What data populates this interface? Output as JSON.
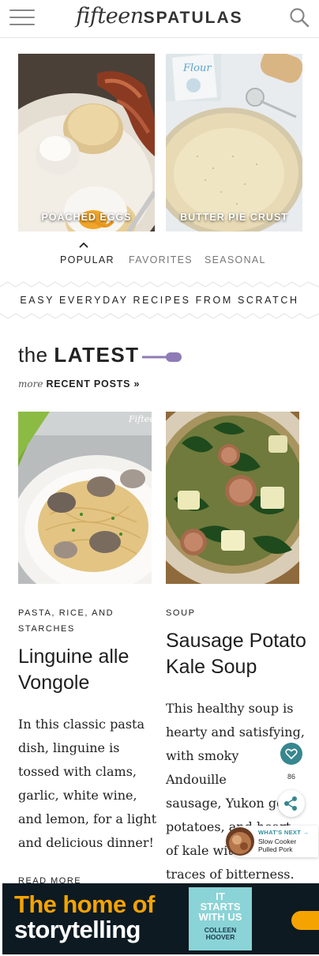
{
  "header": {
    "logo_script": "fifteen",
    "logo_caps": "SPATULAS",
    "menu_icon": "hamburger-menu-icon",
    "search_icon": "search-icon"
  },
  "featured": [
    {
      "label": "POACHED EGGS"
    },
    {
      "label": "BUTTER PIE CRUST"
    }
  ],
  "tabs": [
    {
      "label": "POPULAR",
      "active": true
    },
    {
      "label": "FAVORITES",
      "active": false
    },
    {
      "label": "SEASONAL",
      "active": false
    }
  ],
  "tagline": "EASY EVERYDAY RECIPES FROM SCRATCH",
  "latest": {
    "title_small": "the",
    "title_big": "LATEST",
    "more_prefix": "more",
    "more_link": "RECENT POSTS »"
  },
  "posts": [
    {
      "category_line1": "PASTA, RICE, AND",
      "category_line2": "STARCHES",
      "title_line1": "Linguine alle",
      "title_line2": "Vongole",
      "excerpt": [
        "In this classic pasta",
        "dish, linguine is",
        "tossed with clams,",
        "garlic, white wine,",
        "and lemon, for a light",
        "and delicious dinner!"
      ],
      "image_watermark": "Fiftee",
      "read_more": "READ MORE"
    },
    {
      "category_line1": "SOUP",
      "title_line1": "Sausage Potato",
      "title_line2": "Kale Soup",
      "excerpt": [
        "This healthy soup is",
        "hearty and satisfying,",
        "with smoky",
        "Andouille",
        "sausage, Yukon go",
        "potatoes, and heart",
        "of kale wit",
        "traces of bitterness."
      ]
    }
  ],
  "widgets": {
    "share_count": "86",
    "whats_next_label": "WHAT'S NEXT →",
    "whats_next_title_line1": "Slow Cooker",
    "whats_next_title_line2": "Pulled Pork"
  },
  "ad": {
    "line1": "The home of",
    "line2": "storytelling",
    "book_title_line1": "IT",
    "book_title_line2": "STARTS",
    "book_title_line3": "WITH US",
    "book_author_line1": "COLLEEN",
    "book_author_line2": "HOOVER"
  },
  "colors": {
    "accent_purple": "#8e7bb5",
    "share_teal": "#36878f",
    "ad_orange": "#f5a300",
    "ad_dark": "#0d1a22"
  }
}
